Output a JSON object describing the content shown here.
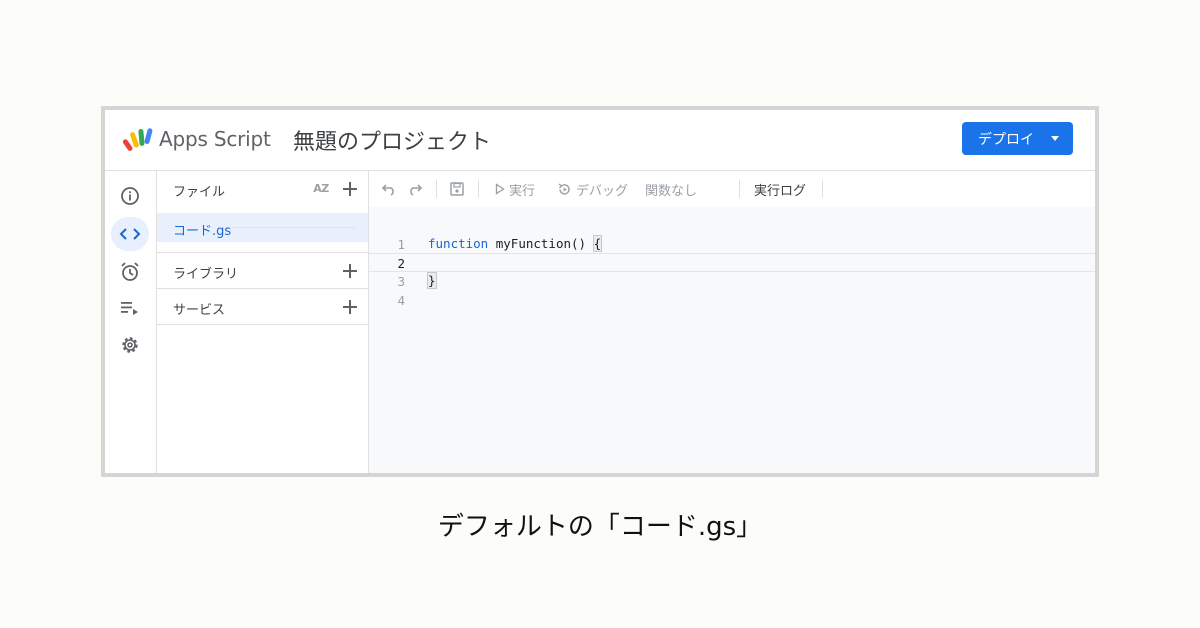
{
  "topbar": {
    "app_name": "Apps Script",
    "project_title": "無題のプロジェクト",
    "deploy_label": "デプロイ"
  },
  "files_panel": {
    "header": "ファイル",
    "sort_icon_label": "AZ",
    "files": [
      {
        "label": "コード.gs"
      }
    ],
    "libraries_label": "ライブラリ",
    "services_label": "サービス"
  },
  "toolbar": {
    "run_label": "実行",
    "debug_label": "デバッグ",
    "function_select": "関数なし",
    "exec_log_label": "実行ログ"
  },
  "editor": {
    "lines": [
      {
        "num": "1",
        "keyword": "function",
        "rest": " myFunction() ",
        "bracket": "{"
      },
      {
        "num": "2"
      },
      {
        "num": "3",
        "bracket": "}"
      },
      {
        "num": "4"
      }
    ]
  },
  "caption": "デフォルトの「コード.gs」",
  "colors": {
    "accent": "#1a73e8",
    "selected_bg": "#e8f0fe",
    "keyword": "#1a66d2"
  }
}
